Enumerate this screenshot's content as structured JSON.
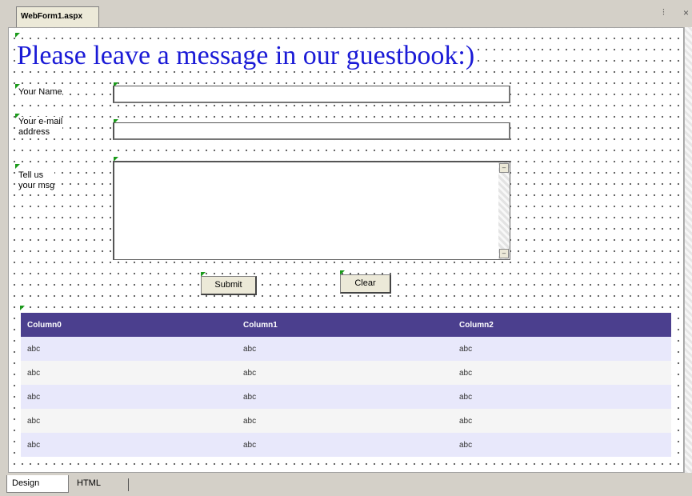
{
  "window": {
    "doc_tab_label": "WebForm1.aspx",
    "pin_glyph": "⫶",
    "close_glyph": "×"
  },
  "form": {
    "title": "Please leave a message in our guestbook:)",
    "name_label": "Your Name",
    "email_label_line1": "Your e-mail",
    "email_label_line2": "address",
    "message_label_line1": "Tell us",
    "message_label_line2": "your msg",
    "name_value": "",
    "email_value": "",
    "message_value": "",
    "submit_label": "Submit",
    "clear_label": "Clear"
  },
  "grid": {
    "columns": [
      "Column0",
      "Column1",
      "Column2"
    ],
    "rows": [
      [
        "abc",
        "abc",
        "abc"
      ],
      [
        "abc",
        "abc",
        "abc"
      ],
      [
        "abc",
        "abc",
        "abc"
      ],
      [
        "abc",
        "abc",
        "abc"
      ],
      [
        "abc",
        "abc",
        "abc"
      ]
    ]
  },
  "view_tabs": {
    "design": "Design",
    "html": "HTML"
  },
  "colors": {
    "title": "#1a1ad6",
    "grid_header": "#4b3f8e",
    "grid_row_alt": "#e8e8fb"
  }
}
